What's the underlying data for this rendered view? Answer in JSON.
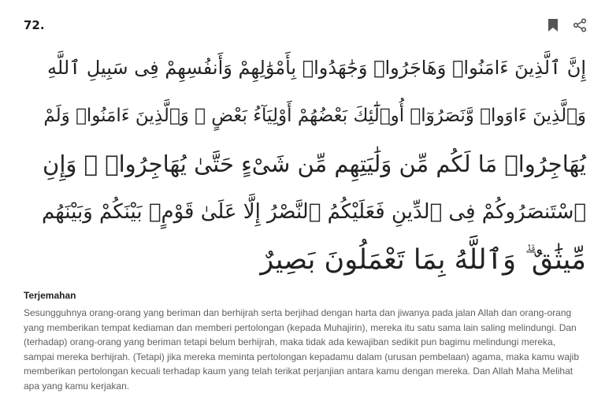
{
  "verse": {
    "number": "72.",
    "arabic_lines": [
      "إِنَّ ٱلَّذِينَ ءَامَنُوا۟ وَهَاجَرُوا۟ وَجَٰهَدُوا۟ بِأَمْوَٰلِهِمْ وَأَنفُسِهِمْ فِى سَبِيلِ ٱللَّهِ",
      "وَٱلَّذِينَ ءَاوَوا۟ وَّنَصَرُوٓا۟ أُو۟لَٰٓئِكَ بَعْضُهُمْ أَوْلِيَآءُ بَعْضٍ ۚ وَٱلَّذِينَ ءَامَنُوا۟ وَلَمْ",
      "يُهَاجِرُوا۟ مَا لَكُم مِّن وَلَٰيَتِهِم مِّن شَىْءٍ حَتَّىٰ يُهَاجِرُوا۟ ۚ وَإِنِ",
      "ٱسْتَنصَرُوكُمْ فِى ٱلدِّينِ فَعَلَيْكُمُ ٱلنَّصْرُ إِلَّا عَلَىٰ قَوْمٍۭ بَيْنَكُمْ وَبَيْنَهُم",
      "مِّيثَٰقٌ ۗ وَٱللَّهُ بِمَا تَعْمَلُونَ بَصِيرٌ"
    ]
  },
  "actions": {
    "bookmark_icon": "bookmark-icon",
    "share_icon": "share-icon"
  },
  "translation": {
    "title": "Terjemahan",
    "text": "Sesungguhnya orang-orang yang beriman dan berhijrah serta berjihad dengan harta dan jiwanya pada jalan Allah dan orang-orang yang memberikan tempat kediaman dan memberi pertolongan (kepada Muhajirin), mereka itu satu sama lain saling melindungi. Dan (terhadap) orang-orang yang beriman tetapi belum berhijrah, maka tidak ada kewajiban sedikit pun bagimu melindungi mereka, sampai mereka berhijrah. (Tetapi) jika mereka meminta pertolongan kepadamu dalam (urusan pembelaan) agama, maka kamu wajib memberikan pertolongan kecuali terhadap kaum yang telah terikat perjanjian antara kamu dengan mereka. Dan Allah Maha Melihat apa yang kamu kerjakan."
  },
  "colors": {
    "icon": "#555555",
    "text": "#222222",
    "muted": "#5f5f5f"
  }
}
